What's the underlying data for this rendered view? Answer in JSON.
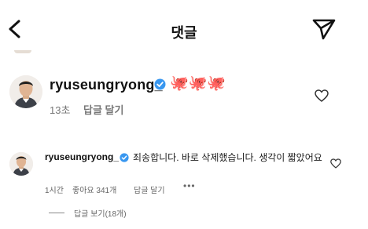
{
  "header": {
    "title": "댓글",
    "back_icon": "chevron-left-icon",
    "send_icon": "send-icon"
  },
  "comment_main": {
    "username": "ryuseungryong_",
    "verified_icon": "verified-badge-icon",
    "emoji": "🐙🐙🐙",
    "time": "13초",
    "reply_label": "답글 달기",
    "like_icon": "heart-icon"
  },
  "comment_reply": {
    "username": "ryuseungryong_",
    "verified_icon": "verified-badge-icon",
    "text": "죄송합니다. 바로 삭제했습니다. 생각이 짧았어요",
    "time": "1시간",
    "likes": "좋아요 341개",
    "reply_label": "답글 달기",
    "more_icon": "ellipsis-icon",
    "more_label": "•••",
    "like_icon": "heart-icon"
  },
  "view_replies": {
    "label": "답글 보기(18개)"
  },
  "colors": {
    "verified": "#3897f0",
    "text_primary": "#111111",
    "text_secondary": "#777777"
  }
}
